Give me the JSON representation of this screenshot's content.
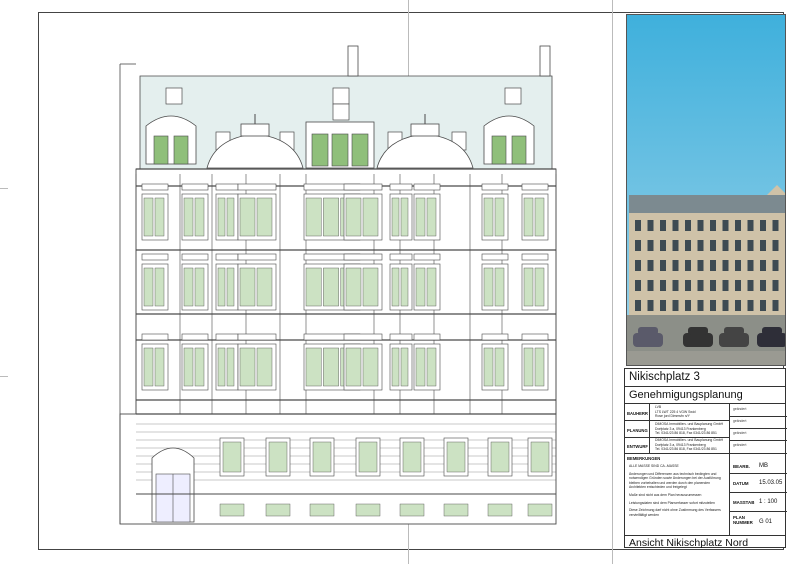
{
  "project_title": "Nikischplatz 3",
  "plan_phase": "Genehmigungsplanung",
  "view_title": "Ansicht Nikischplatz Nord",
  "parties": [
    {
      "label": "BAUHERR",
      "lines": [
        "LVB",
        "LTS LWT 225 4 VGW Swid",
        "Rose jord Dimmsfn n/Y"
      ]
    },
    {
      "label": "PLANUNG",
      "lines": [
        "DIMOSA Immobilien- und Bauplanung GmbH",
        "Dorfplatz 3 a, 09413 Frankenberg",
        "Tel. 0341/23 86 818, Fax 0341/23 86 851"
      ]
    },
    {
      "label": "ENTWURF",
      "lines": [
        "DIMOSA Immobilien- und Bauplanung GmbH",
        "Dorfplatz 3 a, 09413 Frankenberg",
        "Tel. 0341/23 86 818, Fax 0341/23 86 851"
      ]
    }
  ],
  "remarks": {
    "label": "BEMERKUNGEN",
    "lines": [
      "ALLE MASSE SIND CA.-MASSE",
      "Änderungen und Differenzen aus technisch bedingten und",
      "notwendigen Gründen sowie Änderungen bei der Ausführung",
      "bleiben vorbehalten und werden durch den planenden",
      "Architekten entschieden und freigelegt",
      "Maße sind nicht aus dem Plan herauszumessen",
      "Leistungsdaten sind dem Planverfasser sofort mitzuteilen",
      "Diese Zeichnung darf nicht ohne Zustimmung des Verfassers",
      "vervielfältigt werden"
    ]
  },
  "meta": [
    {
      "label": "BEARB.",
      "value": "MB"
    },
    {
      "label": "DATUM",
      "value": "15.03.05"
    },
    {
      "label": "MASSTAB",
      "value": "1 : 100"
    },
    {
      "label": "PLAN NUMMER",
      "value": "G 01"
    }
  ],
  "revision_labels": [
    "geändert",
    "geändert",
    "geändert",
    "geändert"
  ],
  "colors": {
    "facade_stroke": "#4a4a4a",
    "roof_fill": "#e4efee",
    "window_green": "#8fbf7a",
    "sky_top": "#3fb0dc",
    "sky_bottom": "#9fd4ea"
  }
}
